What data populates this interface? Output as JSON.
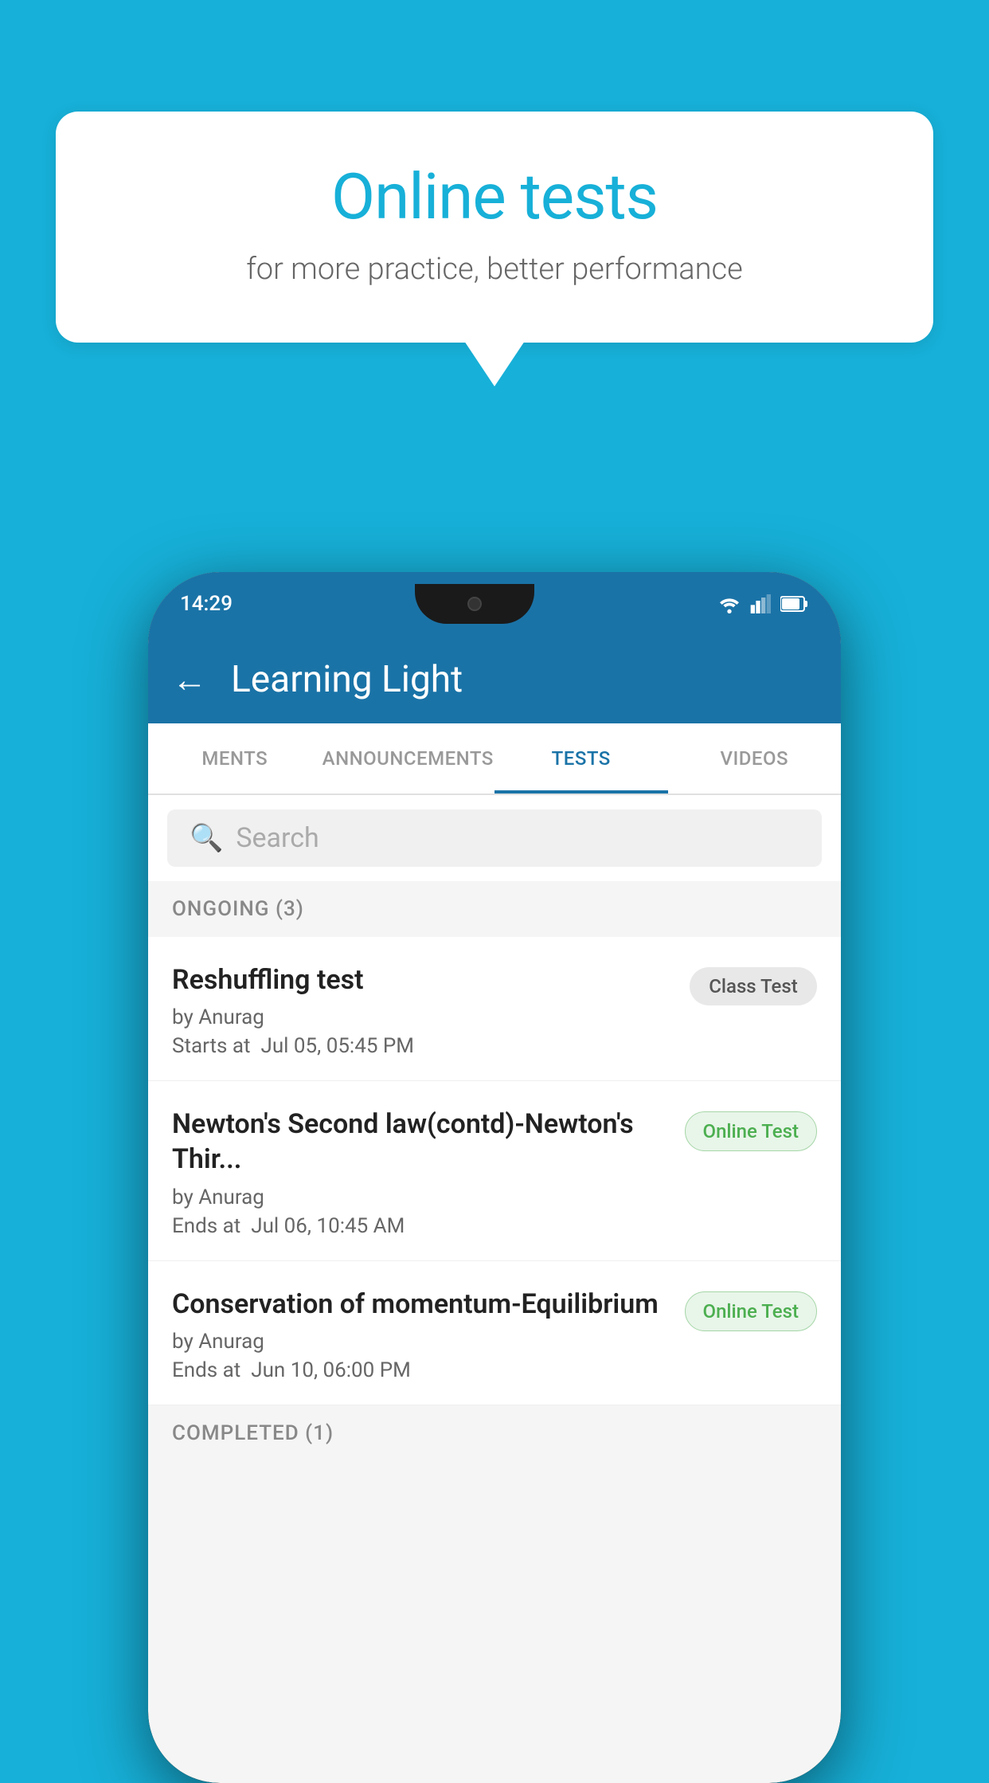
{
  "background_color": "#17b0d8",
  "speech_bubble": {
    "title": "Online tests",
    "subtitle": "for more practice, better performance"
  },
  "phone": {
    "status_bar": {
      "time": "14:29",
      "icons": [
        "wifi",
        "signal",
        "battery"
      ]
    },
    "header": {
      "title": "Learning Light",
      "back_label": "←"
    },
    "tabs": [
      {
        "label": "MENTS",
        "active": false
      },
      {
        "label": "ANNOUNCEMENTS",
        "active": false
      },
      {
        "label": "TESTS",
        "active": true
      },
      {
        "label": "VIDEOS",
        "active": false
      }
    ],
    "search": {
      "placeholder": "Search"
    },
    "ongoing_section": {
      "label": "ONGOING (3)"
    },
    "test_items": [
      {
        "name": "Reshuffling test",
        "author": "by Anurag",
        "time_label": "Starts at",
        "time": "Jul 05, 05:45 PM",
        "badge": "Class Test",
        "badge_type": "class"
      },
      {
        "name": "Newton's Second law(contd)-Newton's Thir...",
        "author": "by Anurag",
        "time_label": "Ends at",
        "time": "Jul 06, 10:45 AM",
        "badge": "Online Test",
        "badge_type": "online"
      },
      {
        "name": "Conservation of momentum-Equilibrium",
        "author": "by Anurag",
        "time_label": "Ends at",
        "time": "Jun 10, 06:00 PM",
        "badge": "Online Test",
        "badge_type": "online"
      }
    ],
    "completed_section": {
      "label": "COMPLETED (1)"
    }
  }
}
